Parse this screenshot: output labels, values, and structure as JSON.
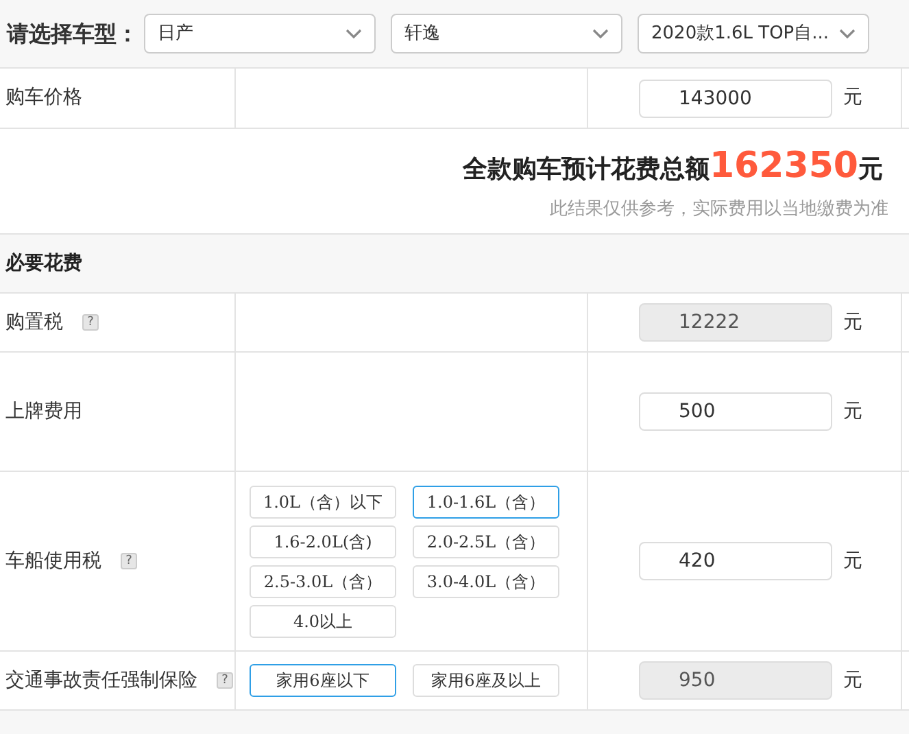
{
  "selector": {
    "label": "请选择车型：",
    "dropdowns": [
      {
        "value": "日产"
      },
      {
        "value": "轩逸"
      },
      {
        "value": "2020款1.6L TOP自..."
      }
    ]
  },
  "price_row": {
    "label": "购车价格",
    "value": "143000",
    "unit": "元"
  },
  "summary": {
    "label": "全款购车预计花费总额",
    "amount": "162350",
    "unit": "元",
    "note": "此结果仅供参考，实际费用以当地缴费为准"
  },
  "section": {
    "title": "必要花费"
  },
  "rows": [
    {
      "label": "购置税",
      "help": "?",
      "options": [],
      "value": "12222",
      "disabled": true,
      "unit": "元"
    },
    {
      "label": "上牌费用",
      "options": [],
      "value": "500",
      "disabled": false,
      "unit": "元"
    },
    {
      "label": "车船使用税",
      "help": "?",
      "options": [
        {
          "label": "1.0L（含）以下",
          "selected": false
        },
        {
          "label": "1.0-1.6L（含）",
          "selected": true
        },
        {
          "label": "1.6-2.0L(含)",
          "selected": false
        },
        {
          "label": "2.0-2.5L（含）",
          "selected": false
        },
        {
          "label": "2.5-3.0L（含）",
          "selected": false
        },
        {
          "label": "3.0-4.0L（含）",
          "selected": false
        },
        {
          "label": "4.0以上",
          "selected": false
        }
      ],
      "value": "420",
      "disabled": false,
      "unit": "元"
    },
    {
      "label": "交通事故责任强制保险",
      "help": "?",
      "options": [
        {
          "label": "家用6座以下",
          "selected": true
        },
        {
          "label": "家用6座及以上",
          "selected": false
        }
      ],
      "value": "950",
      "disabled": true,
      "unit": "元"
    }
  ]
}
